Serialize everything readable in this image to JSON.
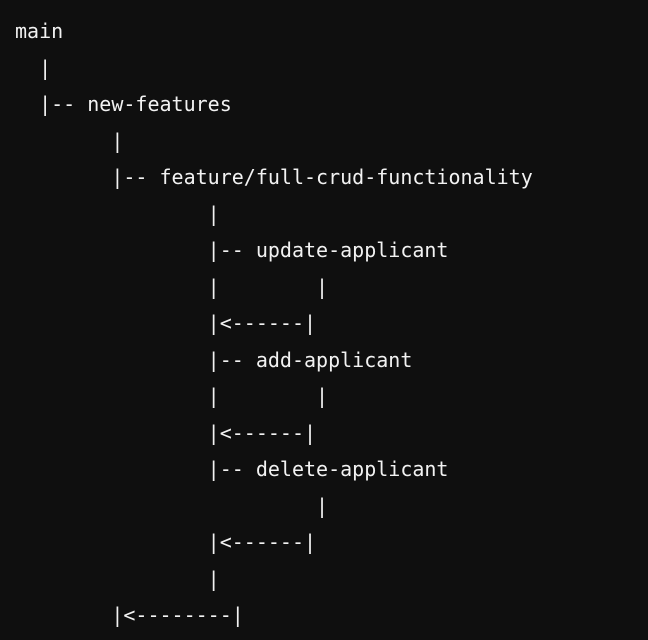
{
  "diagram": {
    "lines": [
      "main",
      "  |",
      "  |-- new-features",
      "        |",
      "        |-- feature/full-crud-functionality",
      "                |",
      "                |-- update-applicant",
      "                |        |",
      "                |<------|",
      "                |-- add-applicant",
      "                |        |",
      "                |<------|",
      "                |-- delete-applicant",
      "                         |",
      "                |<------|",
      "                |",
      "        |<--------|"
    ]
  }
}
